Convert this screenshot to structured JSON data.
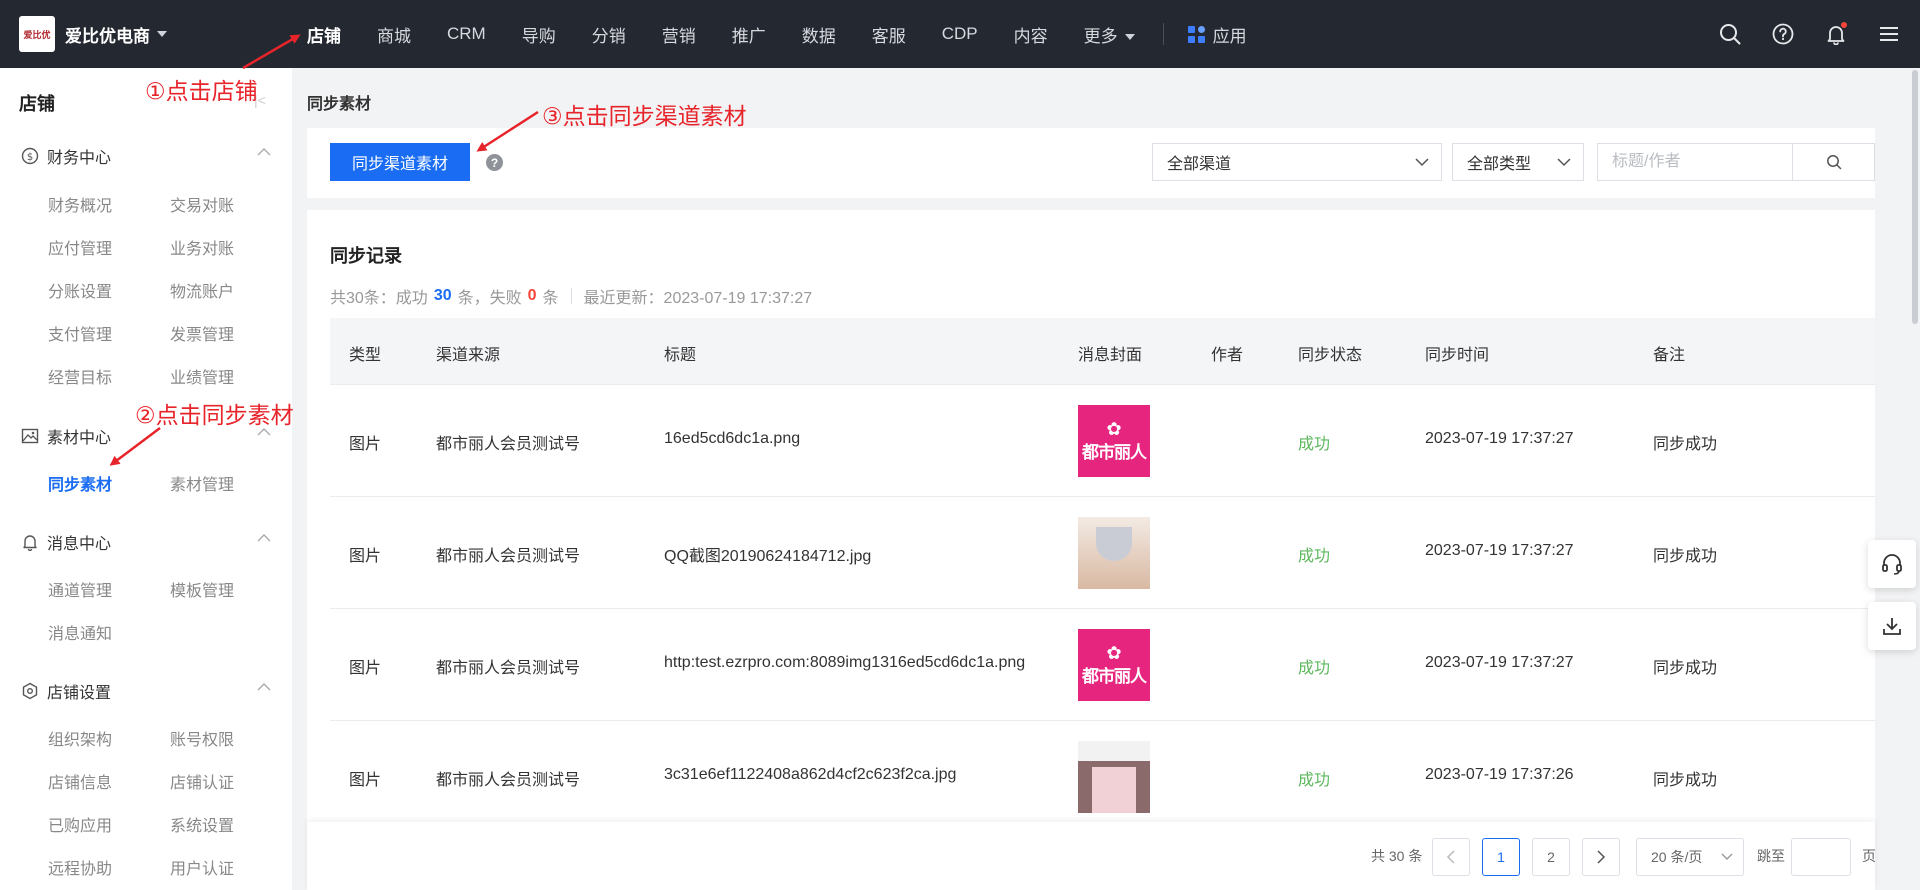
{
  "brand": {
    "logo_text": "爱比优",
    "name": "爱比优电商"
  },
  "nav": {
    "items": [
      "店铺",
      "商城",
      "CRM",
      "导购",
      "分销",
      "营销",
      "推广",
      "数据",
      "客服",
      "CDP",
      "内容"
    ],
    "more": "更多",
    "apps": "应用",
    "active": "店铺"
  },
  "sidebar": {
    "title": "店铺",
    "groups": [
      {
        "label": "财务中心",
        "icon": "dollar-circle-icon",
        "items": [
          "财务概况",
          "交易对账",
          "应付管理",
          "业务对账",
          "分账设置",
          "物流账户",
          "支付管理",
          "发票管理",
          "经营目标",
          "业绩管理"
        ]
      },
      {
        "label": "素材中心",
        "icon": "image-icon",
        "items": [
          "同步素材",
          "素材管理"
        ]
      },
      {
        "label": "消息中心",
        "icon": "bell-icon",
        "items": [
          "通道管理",
          "模板管理",
          "消息通知"
        ]
      },
      {
        "label": "店铺设置",
        "icon": "hexagon-settings-icon",
        "items": [
          "组织架构",
          "账号权限",
          "店铺信息",
          "店铺认证",
          "已购应用",
          "系统设置",
          "远程协助",
          "用户认证"
        ]
      }
    ],
    "active_item": "同步素材"
  },
  "breadcrumb": "同步素材",
  "toolbar": {
    "sync_button": "同步渠道素材",
    "help": "?",
    "channel_select": "全部渠道",
    "type_select": "全部类型",
    "search_placeholder": "标题/作者"
  },
  "records": {
    "title": "同步记录",
    "summary_prefix": "共30条：成功",
    "success_count": "30",
    "unit_and_fail": "条，失败",
    "fail_count": "0",
    "unit": "条",
    "last_update": "最近更新：2023-07-19 17:37:27",
    "columns": [
      "类型",
      "渠道来源",
      "标题",
      "消息封面",
      "作者",
      "同步状态",
      "同步时间",
      "备注"
    ],
    "rows": [
      {
        "type": "图片",
        "source": "都市丽人会员测试号",
        "title": "16ed5cd6dc1a.png",
        "cover": "brand-logo",
        "author": "",
        "status": "成功",
        "time": "2023-07-19 17:37:27",
        "remark": "同步成功"
      },
      {
        "type": "图片",
        "source": "都市丽人会员测试号",
        "title": "QQ截图20190624184712.jpg",
        "cover": "product-photo",
        "author": "",
        "status": "成功",
        "time": "2023-07-19 17:37:27",
        "remark": "同步成功"
      },
      {
        "type": "图片",
        "source": "都市丽人会员测试号",
        "title": "http:test.ezrpro.com:8089img1316ed5cd6dc1a.png",
        "cover": "brand-logo",
        "author": "",
        "status": "成功",
        "time": "2023-07-19 17:37:27",
        "remark": "同步成功"
      },
      {
        "type": "图片",
        "source": "都市丽人会员测试号",
        "title": "3c31e6ef1122408a862d4cf2c623f2ca.jpg",
        "cover": "store-photo",
        "author": "",
        "status": "成功",
        "time": "2023-07-19 17:37:26",
        "remark": "同步成功"
      }
    ],
    "cover_brand_text": "都市丽人"
  },
  "pagination": {
    "total": "共 30 条",
    "pages": [
      "1",
      "2"
    ],
    "current": "1",
    "page_size": "20 条/页",
    "jump_label": "跳至",
    "page_unit": "页"
  },
  "annotations": {
    "step1": "①点击店铺",
    "step2": "②点击同步素材",
    "step3": "③点击同步渠道素材"
  },
  "colors": {
    "topbar": "#242830",
    "primary": "#1a6df2",
    "success": "#5cb85c",
    "fail": "#f5453a",
    "annotation": "#e8242b",
    "brand_pink": "#e6267e"
  }
}
